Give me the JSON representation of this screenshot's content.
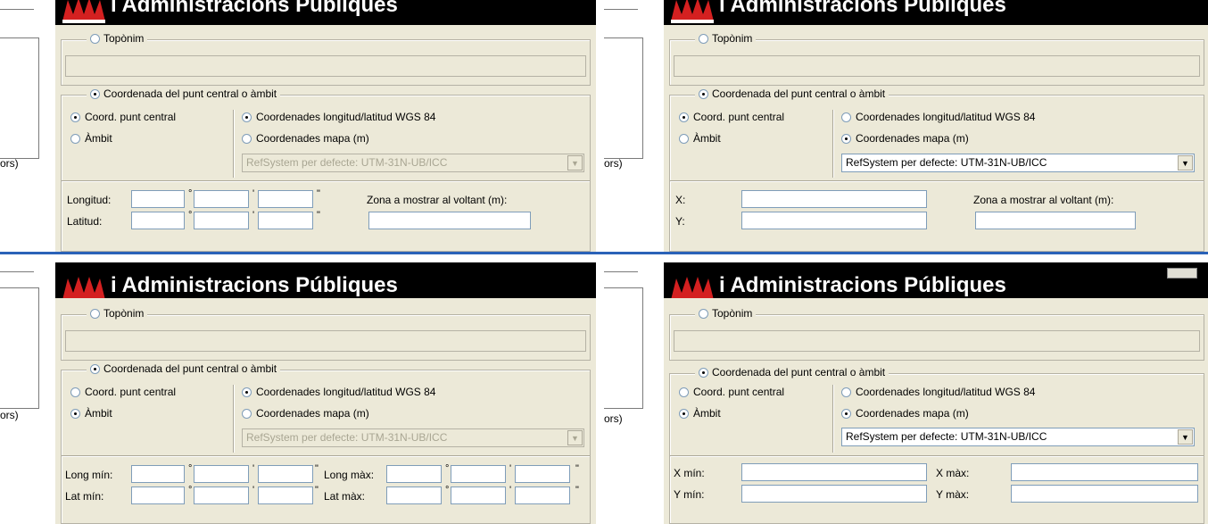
{
  "banner": {
    "title": "i Administracions Públiques"
  },
  "left": {
    "fragment": "ors)"
  },
  "toponim": {
    "label": "Topònim"
  },
  "coord": {
    "group_label": "Coordenada del punt central o àmbit",
    "central_label": "Coord. punt central",
    "ambit_label": "Àmbit",
    "wgs84_label": "Coordenades longitud/latitud WGS 84",
    "mapa_label": "Coordenades mapa (m)",
    "refsystem": "RefSystem per defecte: UTM-31N-UB/ICC"
  },
  "fields": {
    "longitud": "Longitud:",
    "latitud": "Latitud:",
    "zona": "Zona a mostrar al voltant (m):",
    "x": "X:",
    "y": "Y:",
    "long_min": "Long mín:",
    "lat_min": "Lat mín:",
    "long_max": "Long màx:",
    "lat_max": "Lat màx:",
    "x_min": "X mín:",
    "y_min": "Y mín:",
    "x_max": "X màx:",
    "y_max": "Y màx:",
    "deg": "°",
    "min": "'",
    "sec": "\""
  },
  "panels": [
    {
      "mode": "central",
      "system": "wgs84"
    },
    {
      "mode": "central",
      "system": "mapa"
    },
    {
      "mode": "ambit",
      "system": "wgs84"
    },
    {
      "mode": "ambit",
      "system": "mapa"
    }
  ],
  "colors": {
    "dialog": "#ece9d8",
    "banner": "#000000",
    "accent": "#2a62b8"
  }
}
